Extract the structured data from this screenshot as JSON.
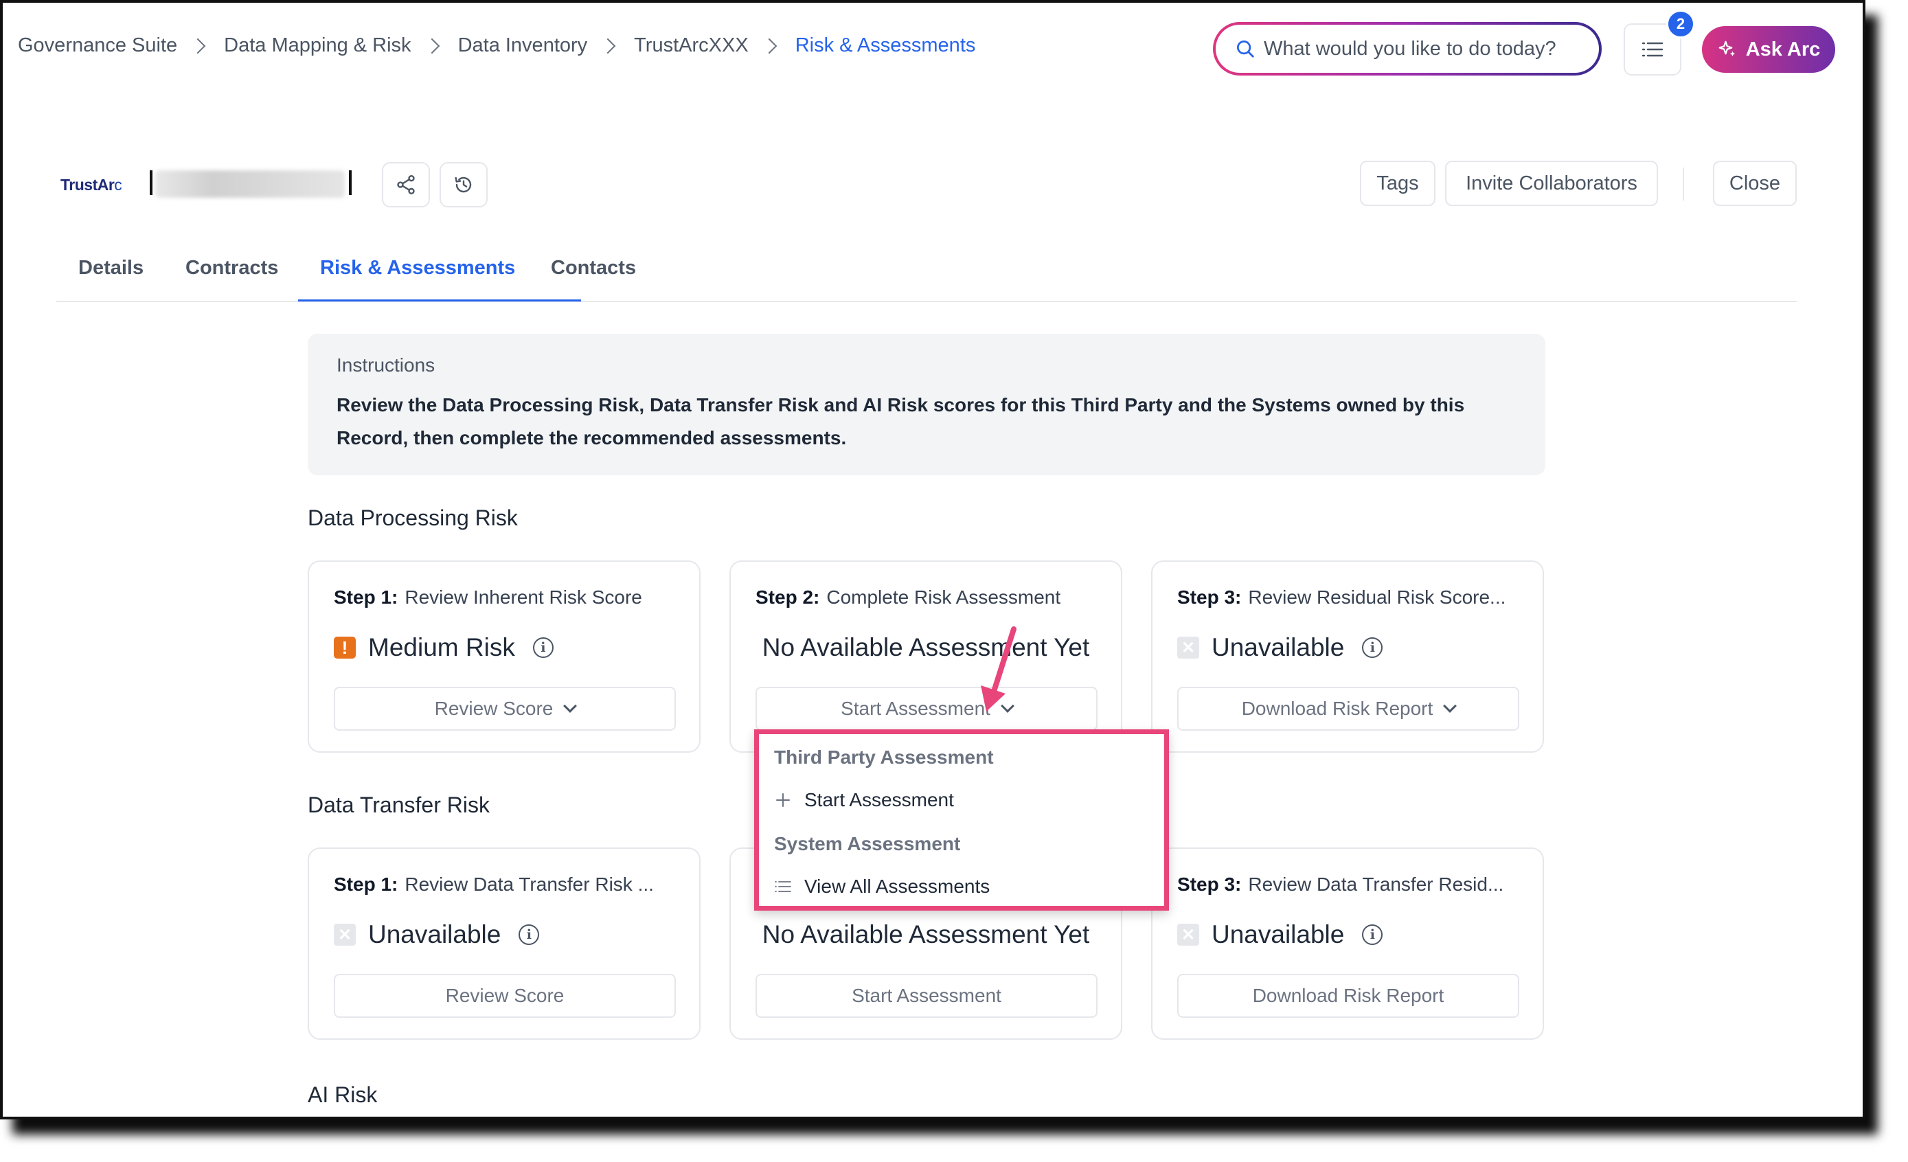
{
  "breadcrumb": {
    "items": [
      "Governance Suite",
      "Data Mapping & Risk",
      "Data Inventory",
      "TrustArcXXX"
    ],
    "current": "Risk & Assessments"
  },
  "search": {
    "placeholder": "What would you like to do today?"
  },
  "header_actions": {
    "notification_count": "2",
    "ask_arc": "Ask Arc",
    "tags": "Tags",
    "invite": "Invite Collaborators",
    "close": "Close"
  },
  "record": {
    "logo_text": "TrustAr",
    "logo_suffix": "c"
  },
  "tabs": [
    {
      "label": "Details"
    },
    {
      "label": "Contracts"
    },
    {
      "label": "Risk & Assessments"
    },
    {
      "label": "Contacts"
    }
  ],
  "instructions": {
    "title": "Instructions",
    "text_line1": "Review the Data Processing Risk, Data Transfer Risk and AI Risk scores for this Third Party and the Systems owned by this",
    "text_line2": "Record, then complete the recommended assessments."
  },
  "sections": {
    "data_processing": {
      "title": "Data Processing Risk",
      "step1": {
        "label": "Step 1:",
        "title": "Review Inherent Risk Score",
        "status": "Medium Risk",
        "button": "Review Score"
      },
      "step2": {
        "label": "Step 2:",
        "title": "Complete Risk Assessment",
        "status": "No Available Assessment Yet",
        "button": "Start Assessment"
      },
      "step3": {
        "label": "Step 3:",
        "title": "Review Residual Risk Score...",
        "status": "Unavailable",
        "button": "Download Risk Report"
      }
    },
    "data_transfer": {
      "title": "Data Transfer Risk",
      "step1": {
        "label": "Step 1:",
        "title": "Review Data Transfer Risk ...",
        "status": "Unavailable",
        "button": "Review Score"
      },
      "step2": {
        "status": "No Available Assessment Yet",
        "button": "Start Assessment"
      },
      "step3": {
        "label": "Step 3:",
        "title": "Review Data Transfer Resid...",
        "status": "Unavailable",
        "button": "Download Risk Report"
      }
    },
    "ai_risk": {
      "title": "AI Risk"
    }
  },
  "dropdown": {
    "group1": "Third Party Assessment",
    "item1": "Start Assessment",
    "group2": "System Assessment",
    "item2": "View All Assessments"
  },
  "colors": {
    "accent": "#2563eb",
    "warning": "#e8711c",
    "highlight": "#e8457b",
    "ask_arc_gradient": [
      "#d63384",
      "#6f2fa8"
    ]
  },
  "icons": [
    "search-icon",
    "list-icon",
    "sparkle-icon",
    "share-icon",
    "history-icon",
    "warning-icon",
    "unavailable-icon",
    "info-icon",
    "chevron-down-icon",
    "plus-icon",
    "list-lines-icon"
  ]
}
